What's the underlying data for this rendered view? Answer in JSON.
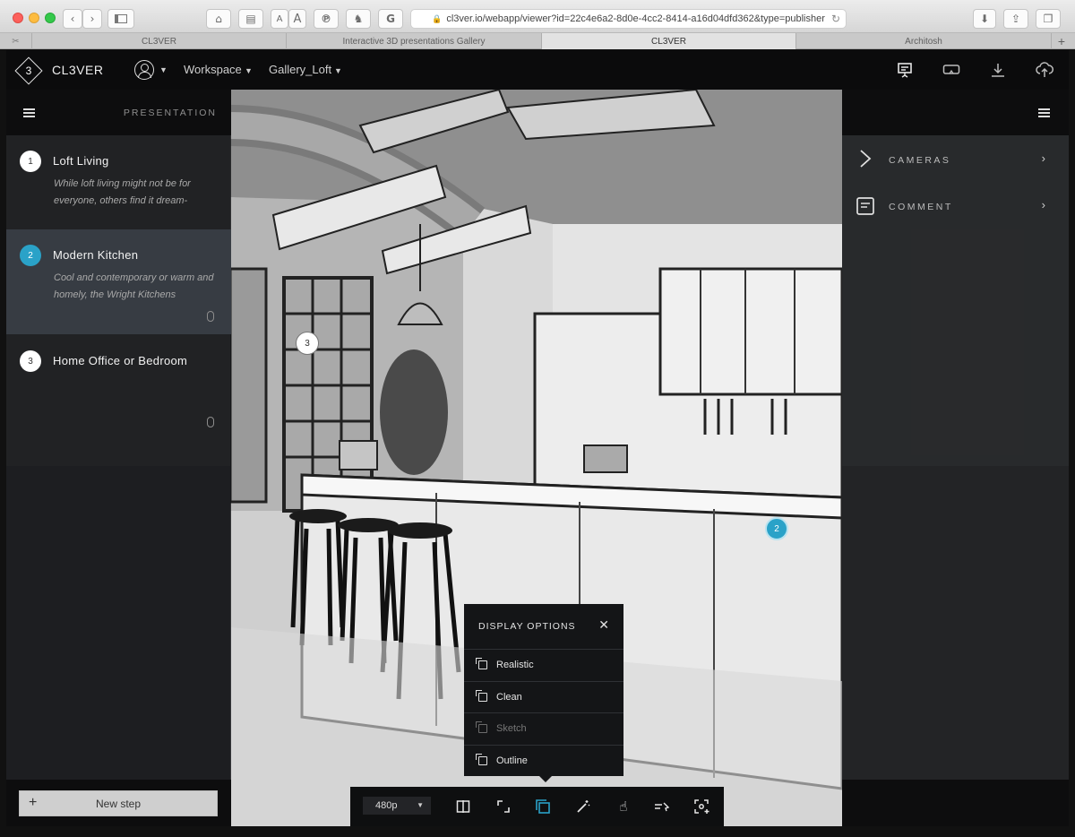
{
  "browser": {
    "url": "cl3ver.io/webapp/viewer?id=22c4e6a2-8d0e-4cc2-8414-a16d04dfd362&type=publisher",
    "font_small": "A",
    "font_large": "A",
    "tabs": [
      {
        "label": "CL3VER",
        "active": false
      },
      {
        "label": "Interactive 3D presentations Gallery",
        "active": false
      },
      {
        "label": "CL3VER",
        "active": true
      },
      {
        "label": "Architosh",
        "active": false
      }
    ]
  },
  "header": {
    "brand": "CL3VER",
    "logo_glyph": "3",
    "workspace_label": "Workspace",
    "gallery_label": "Gallery_Loft",
    "icons": [
      "presentation-icon",
      "vr-headset-icon",
      "download-icon",
      "cloud-upload-icon"
    ]
  },
  "left_panel": {
    "title": "PRESENTATION",
    "steps": [
      {
        "number": "1",
        "title": "Loft Living",
        "description": "While loft living might not be for everyone, others find it dream-",
        "active": false
      },
      {
        "number": "2",
        "title": "Modern Kitchen",
        "description": "Cool and contemporary or warm and homely, the Wright Kitchens",
        "active": true
      },
      {
        "number": "3",
        "title": "Home Office or Bedroom",
        "description": "",
        "active": false
      }
    ],
    "new_step_label": "New step"
  },
  "right_panel": {
    "items": [
      {
        "label": "CAMERAS",
        "icon": "camera-path-icon"
      },
      {
        "label": "COMMENT",
        "icon": "comment-icon"
      }
    ]
  },
  "hotspots": [
    {
      "label": "3",
      "style": "white"
    },
    {
      "label": "2",
      "style": "blue"
    }
  ],
  "display_options": {
    "title": "DISPLAY OPTIONS",
    "options": [
      {
        "label": "Realistic",
        "enabled": true
      },
      {
        "label": "Clean",
        "enabled": true
      },
      {
        "label": "Sketch",
        "enabled": false
      },
      {
        "label": "Outline",
        "enabled": true
      }
    ]
  },
  "toolbar": {
    "resolution": "480p",
    "tools": [
      "split-view-icon",
      "fullscreen-icon",
      "display-options-icon",
      "magic-wand-icon",
      "hand-icon",
      "walk-icon",
      "focus-icon"
    ],
    "active_tool": "display-options-icon"
  },
  "colors": {
    "accent": "#2aa2c8",
    "panel_bg": "#141517",
    "header_bg": "#0b0b0c"
  }
}
